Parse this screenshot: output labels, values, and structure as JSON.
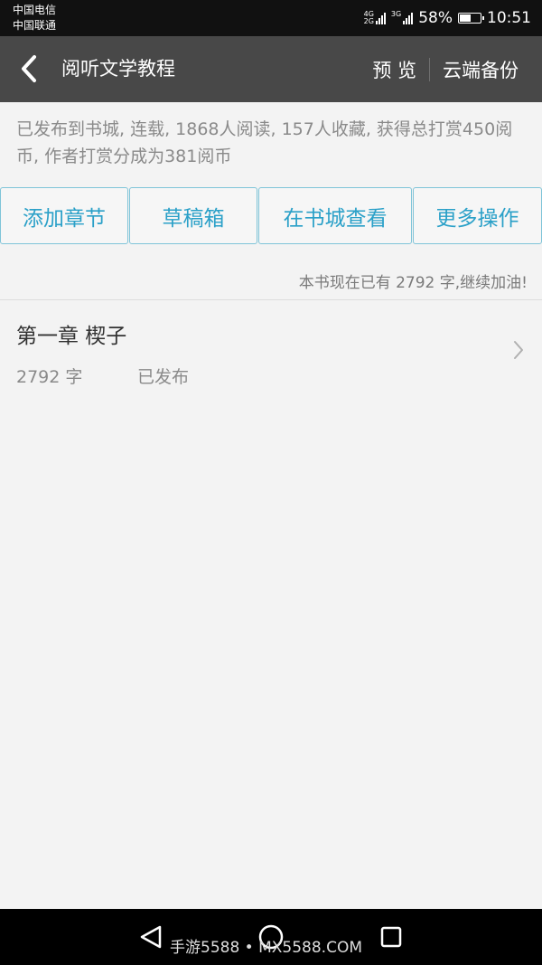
{
  "status_bar": {
    "carrier_1": "中国电信",
    "carrier_2": "中国联通",
    "network_1_top": "4G",
    "network_1_bottom": "2G",
    "network_2": "3G",
    "battery_text": "58%",
    "battery_level": 0.58,
    "time": "10:51"
  },
  "header": {
    "title": "阅听文学教程",
    "preview_label": "预 览",
    "backup_label": "云端备份",
    "back_icon": "chevron-left-icon"
  },
  "info": {
    "text": "已发布到书城, 连载, 1868人阅读, 157人收藏, 获得总打赏450阅币, 作者打赏分成为381阅币"
  },
  "actions": {
    "add_chapter": "添加章节",
    "drafts": "草稿箱",
    "view_in_store": "在书城查看",
    "more_actions": "更多操作"
  },
  "word_count_note": "本书现在已有 2792 字,继续加油!",
  "chapters": [
    {
      "title": "第一章 楔子",
      "words": "2792 字",
      "status": "已发布"
    }
  ],
  "nav_bar": {
    "back_icon": "triangle-back-icon",
    "home_icon": "circle-home-icon",
    "recent_icon": "square-recent-icon"
  },
  "watermark": "手游5588 • MX5588.COM",
  "colors": {
    "header_bg": "#484848",
    "accent": "#2aa0c8",
    "button_border": "#7fc4d8",
    "page_bg": "#f3f3f3"
  }
}
